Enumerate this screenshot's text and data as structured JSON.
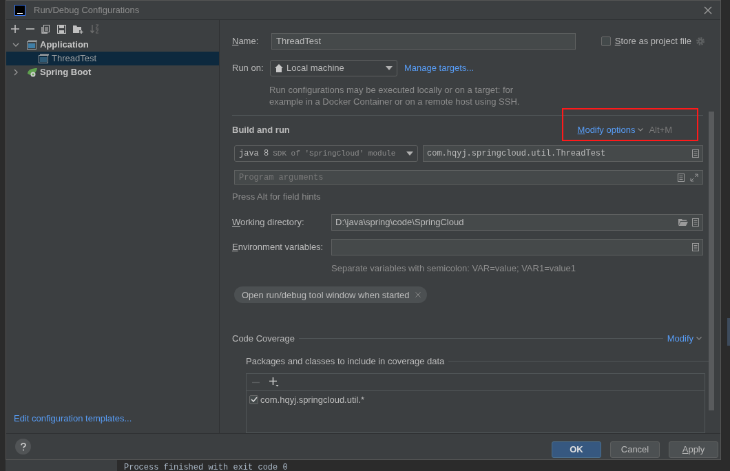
{
  "window": {
    "title": "Run/Debug Configurations"
  },
  "tree": [
    {
      "label": "Application",
      "kind": "application",
      "expanded": true,
      "selected": false,
      "children": [
        {
          "label": "ThreadTest",
          "kind": "application-item",
          "selected": true
        }
      ]
    },
    {
      "label": "Spring Boot",
      "kind": "spring",
      "expanded": false,
      "selected": false
    }
  ],
  "templates_link": "Edit configuration templates...",
  "name": {
    "label": "Name:",
    "mnemonic": true,
    "value": "ThreadTest"
  },
  "store_as_project_file": {
    "label": "Store as project file",
    "mnemonic": true,
    "checked": false
  },
  "run_on": {
    "label": "Run on:",
    "value": "Local machine",
    "link": "Manage targets...",
    "hint": "Run configurations may be executed locally or on a target: for example in a Docker Container or on a remote host using SSH."
  },
  "build_and_run": {
    "title": "Build and run",
    "modify_options": "Modify options",
    "shortcut": "Alt+M",
    "jre": {
      "version": "java 8",
      "detail": "SDK of 'SpringCloud' module"
    },
    "main_class": "com.hqyj.springcloud.util.ThreadTest",
    "program_arguments": {
      "placeholder": "Program arguments"
    },
    "field_hint": "Press Alt for field hints",
    "working_directory": {
      "label": "Working directory:",
      "mnemonic": true,
      "value": "D:\\java\\spring\\code\\SpringCloud"
    },
    "environment_variables": {
      "label": "Environment variables:",
      "mnemonic": true
    },
    "env_hint": "Separate variables with semicolon: VAR=value; VAR1=value1",
    "options": [
      "Open run/debug tool window when started"
    ]
  },
  "code_coverage": {
    "title": "Code Coverage",
    "modify": "Modify",
    "packages_title": "Packages and classes to include in coverage data",
    "entries": [
      {
        "label": "com.hqyj.springcloud.util.*",
        "checked": true
      }
    ]
  },
  "buttons": [
    {
      "label": "OK",
      "kind": "primary"
    },
    {
      "label": "Cancel",
      "kind": "secondary"
    },
    {
      "label": "Apply",
      "kind": "secondary",
      "mnemonic": true
    }
  ],
  "console": {
    "text": "Process finished with exit code 0"
  }
}
